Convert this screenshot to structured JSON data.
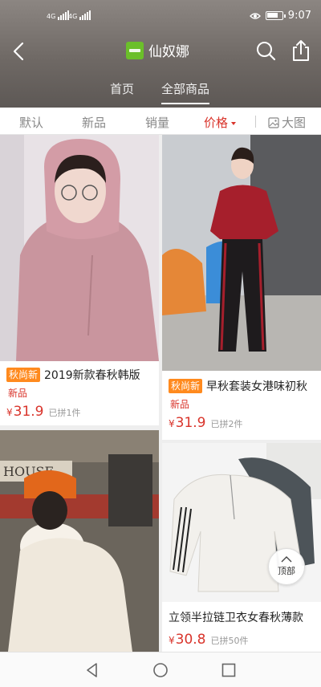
{
  "status_bar": {
    "signal_1": "4G",
    "signal_2": "4G",
    "time": "9:07",
    "battery_level": 0.8,
    "icons": [
      "signal-icon",
      "eye-icon",
      "battery-icon"
    ]
  },
  "nav": {
    "store_name": "仙奴娜",
    "icons": [
      "back-icon",
      "search-icon",
      "share-icon"
    ]
  },
  "tabs": [
    {
      "label": "首页",
      "active": false
    },
    {
      "label": "全部商品",
      "active": true
    }
  ],
  "sort_bar": {
    "default_label": "默认",
    "new_label": "新品",
    "sales_label": "销量",
    "price_label": "价格",
    "big_image_label": "大图",
    "active": "价格"
  },
  "products": [
    {
      "badge": "秋尚新",
      "title": "2019新款春秋韩版",
      "tag": "新品",
      "currency": "¥",
      "price": "31.9",
      "sold": "已拼1件"
    },
    {
      "badge": "秋尚新",
      "title": "早秋套装女港味初秋",
      "tag": "新品",
      "currency": "¥",
      "price": "31.9",
      "sold": "已拼2件"
    },
    {
      "badge": "",
      "title": "",
      "tag": "",
      "currency": "",
      "price": "",
      "sold": ""
    },
    {
      "badge": "",
      "title": "立领半拉链卫衣女春秋薄款",
      "tag": "",
      "currency": "¥",
      "price": "30.8",
      "sold": "已拼50件"
    }
  ],
  "back_to_top_label": "顶部",
  "colors": {
    "accent_red": "#d9342b",
    "badge_orange": "#ff8a1e",
    "store_logo_green": "#6bbf2a",
    "header_gray": "#6f6965"
  }
}
